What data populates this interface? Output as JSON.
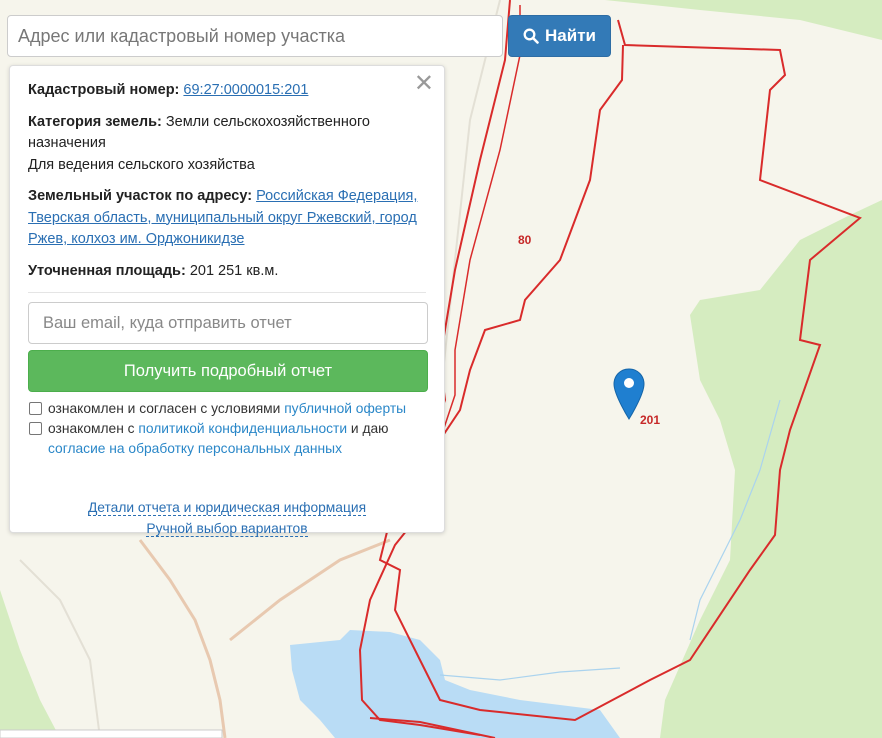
{
  "search": {
    "placeholder": "Адрес или кадастровый номер участка",
    "button_label": "Найти"
  },
  "panel": {
    "close_symbol": "✕",
    "cadastral_label": "Кадастровый номер:",
    "cadastral_number": "69:27:0000015:201",
    "category_label": "Категория земель:",
    "category_value": "Земли сельскохозяйственного назначения",
    "usage_value": "Для ведения сельского хозяйства",
    "address_label": "Земельный участок по адресу:",
    "address_value": "Российская Федерация, Тверская область, муниципальный округ Ржевский, город Ржев, колхоз им. Орджоникидзе",
    "area_label": "Уточненная площадь:",
    "area_value": "201 251 кв.м.",
    "email_placeholder": "Ваш email, куда отправить отчет",
    "report_button": "Получить подробный отчет",
    "checkbox1_text": "ознакомлен и согласен с условиями",
    "checkbox1_link": "публичной оферты",
    "checkbox2_text_a": "ознакомлен с",
    "checkbox2_link1": "политикой конфиденциальности",
    "checkbox2_text_b": "и даю",
    "checkbox2_link2": "согласие на обработку персональных данных",
    "details_link": "Детали отчета и юридическая информация",
    "manual_link": "Ручной выбор вариантов"
  },
  "map": {
    "parcel_labels": [
      "80",
      "201"
    ],
    "colors": {
      "background": "#f6f5ec",
      "forest": "#d5ecc0",
      "water": "#b9dcf5",
      "parcel_border": "#d92b2b",
      "marker": "#1f7fd0",
      "road": "#e8c9b0"
    }
  }
}
